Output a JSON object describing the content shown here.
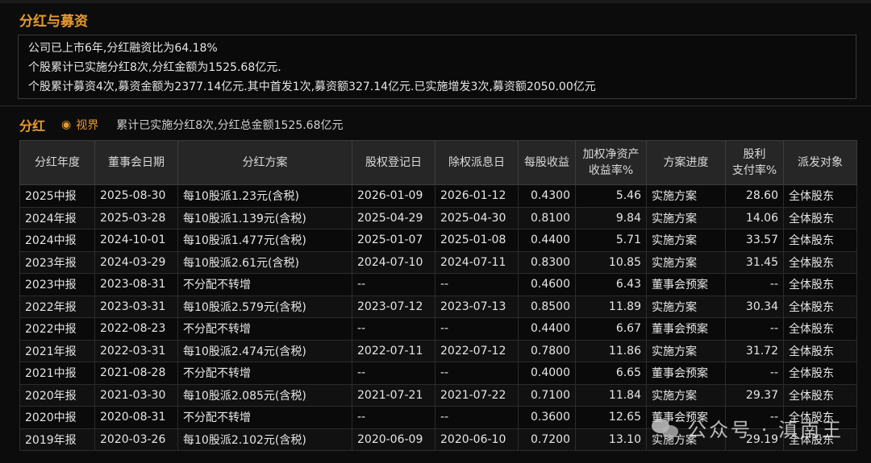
{
  "section": {
    "title": "分红与募资"
  },
  "summary": {
    "lines": [
      "公司已上市6年,分红融资比为64.18%",
      "个股累计已实施分红8次,分红金额为1525.68亿元.",
      "个股累计募资4次,募资金额为2377.14亿元.其中首发1次,募资额327.14亿元.已实施增发3次,募资额2050.00亿元"
    ]
  },
  "dividend": {
    "title": "分红",
    "view_label": "视界",
    "total_text": "累计已实施分红8次,分红总金额1525.68亿元",
    "headers": [
      "分红年度",
      "董事会日期",
      "分红方案",
      "股权登记日",
      "除权派息日",
      "每股收益",
      "加权净资产\n收益率%",
      "方案进度",
      "股利\n支付率%",
      "派发对象"
    ],
    "rows": [
      [
        "2025中报",
        "2025-08-30",
        "每10股派1.23元(含税)",
        "2026-01-09",
        "2026-01-12",
        "0.4300",
        "5.46",
        "实施方案",
        "28.60",
        "全体股东"
      ],
      [
        "2024年报",
        "2025-03-28",
        "每10股派1.139元(含税)",
        "2025-04-29",
        "2025-04-30",
        "0.8100",
        "9.84",
        "实施方案",
        "14.06",
        "全体股东"
      ],
      [
        "2024中报",
        "2024-10-01",
        "每10股派1.477元(含税)",
        "2025-01-07",
        "2025-01-08",
        "0.4400",
        "5.71",
        "实施方案",
        "33.57",
        "全体股东"
      ],
      [
        "2023年报",
        "2024-03-29",
        "每10股派2.61元(含税)",
        "2024-07-10",
        "2024-07-11",
        "0.8300",
        "10.85",
        "实施方案",
        "31.45",
        "全体股东"
      ],
      [
        "2023中报",
        "2023-08-31",
        "不分配不转增",
        "--",
        "--",
        "0.4600",
        "6.43",
        "董事会预案",
        "--",
        "全体股东"
      ],
      [
        "2022年报",
        "2023-03-31",
        "每10股派2.579元(含税)",
        "2023-07-12",
        "2023-07-13",
        "0.8500",
        "11.89",
        "实施方案",
        "30.34",
        "全体股东"
      ],
      [
        "2022中报",
        "2022-08-23",
        "不分配不转增",
        "--",
        "--",
        "0.4400",
        "6.67",
        "董事会预案",
        "--",
        "全体股东"
      ],
      [
        "2021年报",
        "2022-03-31",
        "每10股派2.474元(含税)",
        "2022-07-11",
        "2022-07-12",
        "0.7800",
        "11.86",
        "实施方案",
        "31.72",
        "全体股东"
      ],
      [
        "2021中报",
        "2021-08-28",
        "不分配不转增",
        "--",
        "--",
        "0.4000",
        "6.65",
        "董事会预案",
        "--",
        "全体股东"
      ],
      [
        "2020年报",
        "2021-03-30",
        "每10股派2.085元(含税)",
        "2021-07-21",
        "2021-07-22",
        "0.7100",
        "11.84",
        "实施方案",
        "29.37",
        "全体股东"
      ],
      [
        "2020中报",
        "2020-08-31",
        "不分配不转增",
        "--",
        "--",
        "0.3600",
        "12.65",
        "董事会预案",
        "--",
        "全体股东"
      ],
      [
        "2019年报",
        "2020-03-26",
        "每10股派2.102元(含税)",
        "2020-06-09",
        "2020-06-10",
        "0.7200",
        "13.10",
        "实施方案",
        "29.19",
        "全体股东"
      ]
    ]
  },
  "watermark": {
    "text": "公众号 · 滇南王",
    "icon": "wechat-icon"
  },
  "colors": {
    "accent": "#e79a2e",
    "background": "#0c0c0c",
    "header_bg": "#262626"
  }
}
